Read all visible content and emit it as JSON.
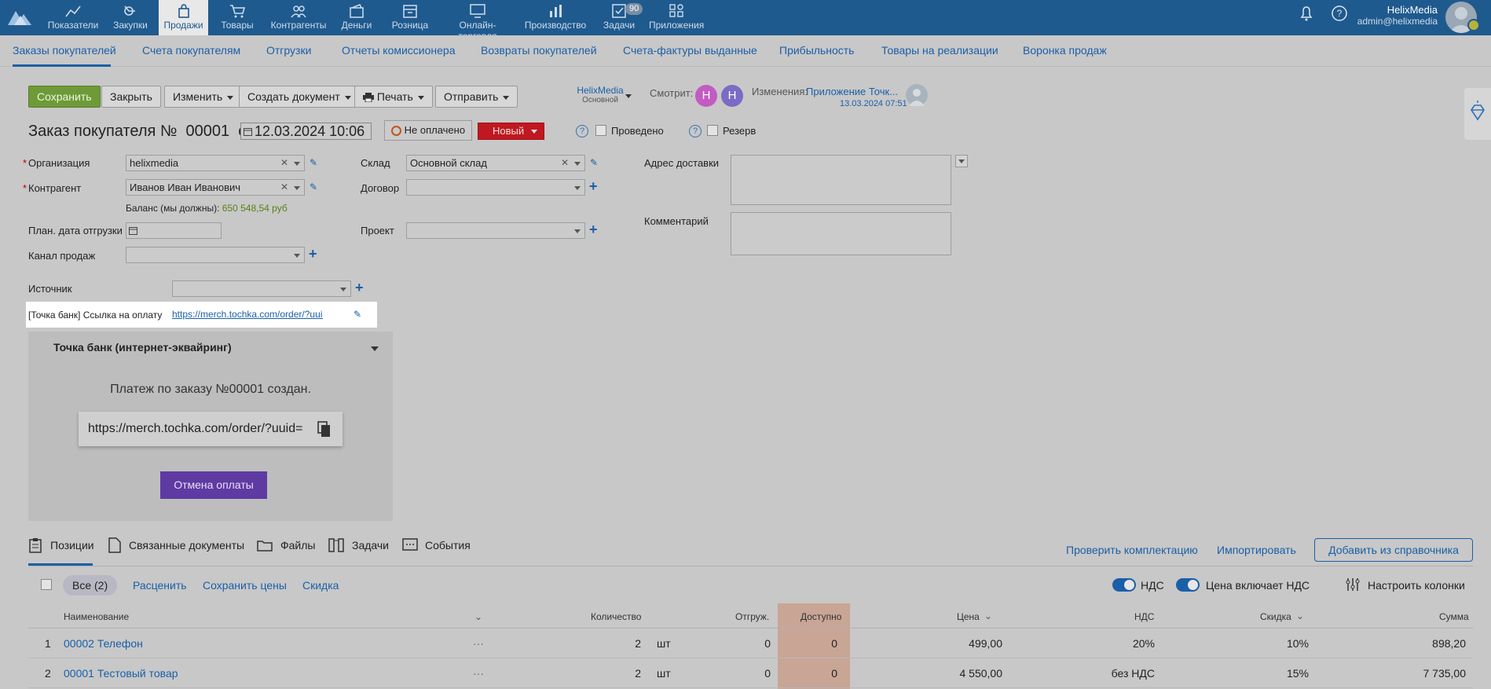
{
  "topnav": {
    "items": [
      {
        "label": "Показатели"
      },
      {
        "label": "Закупки"
      },
      {
        "label": "Продажи"
      },
      {
        "label": "Товары"
      },
      {
        "label": "Контрагенты"
      },
      {
        "label": "Деньги"
      },
      {
        "label": "Розница"
      },
      {
        "label": "Онлайн-торговля"
      },
      {
        "label": "Производство"
      },
      {
        "label": "Задачи",
        "badge": "90"
      },
      {
        "label": "Приложения"
      }
    ],
    "user_name": "HelixMedia",
    "user_email": "admin@helixmedia"
  },
  "subnav": {
    "tabs": [
      "Заказы покупателей",
      "Счета покупателям",
      "Отгрузки",
      "Отчеты комиссионера",
      "Возвраты покупателей",
      "Счета-фактуры выданные",
      "Прибыльность",
      "Товары на реализации",
      "Воронка продаж"
    ]
  },
  "toolbar": {
    "save": "Сохранить",
    "close": "Закрыть",
    "edit": "Изменить",
    "create_doc": "Создать документ",
    "print": "Печать",
    "send": "Отправить",
    "account_name": "HelixMedia",
    "account_sub": "Основной",
    "watching_label": "Смотрит:",
    "watchers": [
      "H",
      "H"
    ],
    "changes_label": "Изменения:",
    "changes_source": "Приложение Точк...",
    "changes_date": "13.03.2024 07:51"
  },
  "order": {
    "title_prefix": "Заказ покупателя №",
    "number": "00001",
    "from_label": "от",
    "date": "12.03.2024 10:06",
    "payment_status": "Не оплачено",
    "state": "Новый",
    "posted_label": "Проведено",
    "reserve_label": "Резерв"
  },
  "form": {
    "org_label": "Организация",
    "org_value": "helixmedia",
    "counterparty_label": "Контрагент",
    "counterparty_value": "Иванов Иван Иванович",
    "balance_label": "Баланс (мы должны):",
    "balance_value": "650 548,54 руб",
    "ship_date_label": "План. дата отгрузки",
    "channel_label": "Канал продаж",
    "warehouse_label": "Склад",
    "warehouse_value": "Основной склад",
    "contract_label": "Договор",
    "project_label": "Проект",
    "delivery_label": "Адрес доставки",
    "comment_label": "Комментарий",
    "source_label": "Источник",
    "pay_link_label": "[Точка банк] Ссылка на оплату",
    "pay_link_value": "https://merch.tochka.com/order/?uuid=..."
  },
  "widget": {
    "title": "Точка банк (интернет-эквайринг)",
    "message": "Платеж по заказу №00001 создан.",
    "link": "https://merch.tochka.com/order/?uuid=",
    "cancel": "Отмена оплаты"
  },
  "bottom_tabs": {
    "positions": "Позиции",
    "linked": "Связанные документы",
    "files": "Файлы",
    "tasks": "Задачи",
    "events": "События",
    "check": "Проверить комплектацию",
    "import": "Импортировать",
    "add": "Добавить из справочника"
  },
  "table_tools": {
    "all": "Все (2)",
    "reprice": "Расценить",
    "save_prices": "Сохранить цены",
    "discount": "Скидка",
    "vat": "НДС",
    "price_incl_vat": "Цена включает НДС",
    "columns": "Настроить колонки"
  },
  "table": {
    "headers": {
      "name": "Наименование",
      "qty": "Количество",
      "shipped": "Отгруж.",
      "available": "Доступно",
      "price": "Цена",
      "vat": "НДС",
      "discount": "Скидка",
      "sum": "Сумма"
    },
    "rows": [
      {
        "n": "1",
        "name": "00002 Телефон",
        "more": "···",
        "qty": "2",
        "unit": "шт",
        "shipped": "0",
        "available": "0",
        "price": "499,00",
        "vat": "20%",
        "discount": "10%",
        "sum": "898,20"
      },
      {
        "n": "2",
        "name": "00001 Тестовый товар",
        "more": "···",
        "qty": "2",
        "unit": "шт",
        "shipped": "0",
        "available": "0",
        "price": "4 550,00",
        "vat": "без НДС",
        "discount": "15%",
        "sum": "7 735,00"
      }
    ]
  }
}
